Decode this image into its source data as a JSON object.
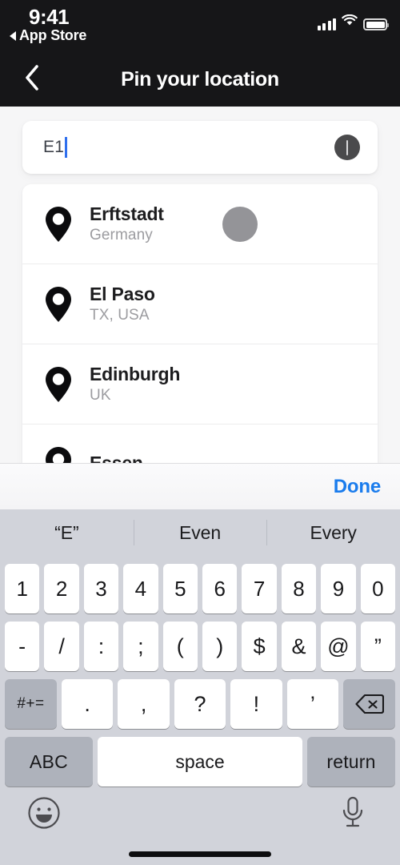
{
  "status_bar": {
    "time": "9:41",
    "return_app_label": "App Store",
    "return_triangle_icon": "triangle-left-icon",
    "signal_icon": "cellular-signal-icon",
    "wifi_icon": "wifi-icon",
    "battery_icon": "battery-full-icon"
  },
  "navbar": {
    "back_icon": "chevron-left-icon",
    "title": "Pin your location"
  },
  "search": {
    "value": "E1",
    "placeholder": "",
    "clear_icon": "clear-field-icon"
  },
  "results": {
    "items": [
      {
        "name": "Erftstadt",
        "subtitle": "Germany",
        "icon": "map-pin-icon"
      },
      {
        "name": "El Paso",
        "subtitle": "TX, USA",
        "icon": "map-pin-icon"
      },
      {
        "name": "Edinburgh",
        "subtitle": "UK",
        "icon": "map-pin-icon"
      },
      {
        "name": "Essen",
        "subtitle": "",
        "icon": "map-pin-icon"
      }
    ],
    "touch_indicator_color": "#949498"
  },
  "accessory_bar": {
    "done_label": "Done",
    "done_color": "#1a7ced"
  },
  "keyboard": {
    "predictions": [
      "“E”",
      "Even",
      "Every"
    ],
    "row1": [
      "1",
      "2",
      "3",
      "4",
      "5",
      "6",
      "7",
      "8",
      "9",
      "0"
    ],
    "row2": [
      "-",
      "/",
      ":",
      ";",
      "(",
      ")",
      "$",
      "&",
      "@",
      "”"
    ],
    "row3": {
      "shift_label": "#+=",
      "keys": [
        ".",
        ",",
        "?",
        "!",
        "’"
      ],
      "delete_icon": "backspace-icon"
    },
    "row4": {
      "abc_label": "ABC",
      "space_label": "space",
      "return_label": "return"
    },
    "bottom": {
      "emoji_icon": "emoji-smiley-icon",
      "mic_icon": "microphone-icon",
      "home_indicator": "home-indicator"
    }
  }
}
